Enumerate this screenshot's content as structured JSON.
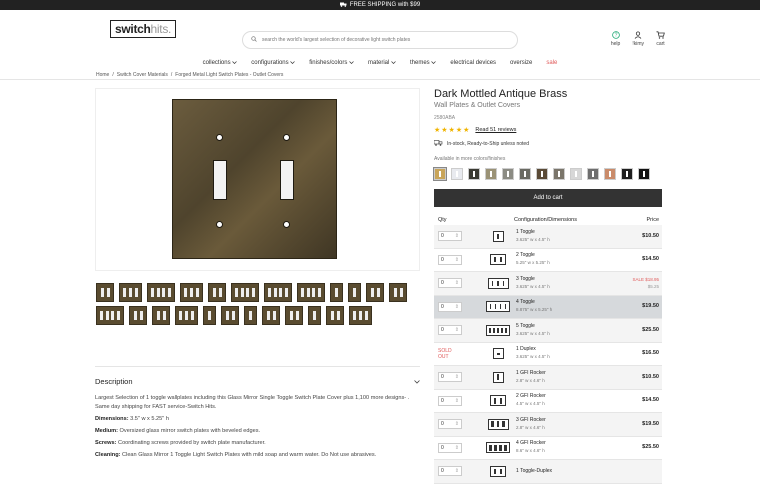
{
  "topbar": {
    "text": "FREE SHIPPING with $99"
  },
  "logo": {
    "part1": "switch",
    "part2": "hits."
  },
  "search": {
    "placeholder": "search the world's largest selection of decorative light switch plates"
  },
  "header_icons": [
    {
      "name": "help",
      "label": "help",
      "icon": "help-icon"
    },
    {
      "name": "account",
      "label": "!kimy",
      "icon": "user-icon"
    },
    {
      "name": "cart",
      "label": "cart",
      "icon": "cart-icon"
    }
  ],
  "nav": [
    "collections",
    "configurations",
    "finishes/colors",
    "material",
    "themes",
    "electrical devices",
    "oversize",
    "sale"
  ],
  "breadcrumb": [
    "Home",
    "Switch Cover Materials",
    "Forged Metal Light Switch Plates - Outlet Covers"
  ],
  "product": {
    "title": "Dark Mottled Antique Brass",
    "subtitle": "Wall Plates & Outlet Covers",
    "sku": "2580ABA",
    "stars": "★★★★★",
    "reviews_link": "Read 51 reviews",
    "stock": "In-stock, Ready-to-Ship unless noted",
    "available_label": "Available in more colors/finishes",
    "add_to_cart": "Add to cart",
    "swatch_colors": [
      "#c9a55a",
      "#e8eaef",
      "#3a3a32",
      "#9a9276",
      "#8b8b83",
      "#6a6a62",
      "#5a4a36",
      "#7a756a",
      "#d7d7d7",
      "#6e6e6e",
      "#c98b6a",
      "#1e1e1e",
      "#111111"
    ]
  },
  "table": {
    "headers": {
      "qty": "Qty",
      "config": "Configuration/Dimensions",
      "price": "Price"
    },
    "rows": [
      {
        "qty": "0",
        "name": "1 Toggle",
        "dims": "3.625\" w x 4.5\" h",
        "price": "$10.50",
        "sale": "",
        "strike": "",
        "gangs": 1,
        "kind": "toggle",
        "soldout": ""
      },
      {
        "qty": "0",
        "name": "2 Toggle",
        "dims": "5.25\" w x 5.25\" h",
        "price": "$14.50",
        "sale": "",
        "strike": "",
        "gangs": 2,
        "kind": "toggle",
        "soldout": ""
      },
      {
        "qty": "0",
        "name": "3 Toggle",
        "dims": "3.625\" w x 4.5\" h",
        "price": "",
        "sale": "SALE $18.95",
        "strike": "$5.25",
        "gangs": 3,
        "kind": "toggle",
        "soldout": ""
      },
      {
        "qty": "0",
        "name": "4 Toggle",
        "dims": "8.875\" w x 5.25\" h",
        "price": "$19.50",
        "sale": "",
        "strike": "",
        "gangs": 4,
        "kind": "toggle",
        "soldout": ""
      },
      {
        "qty": "0",
        "name": "5 Toggle",
        "dims": "3.625\" w x 4.5\" h",
        "price": "$25.50",
        "sale": "",
        "strike": "",
        "gangs": 5,
        "kind": "toggle",
        "soldout": ""
      },
      {
        "qty": "",
        "name": "1 Duplex",
        "dims": "3.625\" w x 4.5\" h",
        "price": "$16.50",
        "sale": "",
        "strike": "",
        "gangs": 1,
        "kind": "duplex",
        "soldout": "SOLD OUT"
      },
      {
        "qty": "0",
        "name": "1 GFI Rocker",
        "dims": "2.8\" w x 4.6\" h",
        "price": "$10.50",
        "sale": "",
        "strike": "",
        "gangs": 1,
        "kind": "gfi",
        "soldout": ""
      },
      {
        "qty": "0",
        "name": "2 GFI Rocker",
        "dims": "4.5\" w x 4.5\" h",
        "price": "$14.50",
        "sale": "",
        "strike": "",
        "gangs": 2,
        "kind": "gfi",
        "soldout": ""
      },
      {
        "qty": "0",
        "name": "3 GFI Rocker",
        "dims": "2.8\" w x 4.6\" h",
        "price": "$19.50",
        "sale": "",
        "strike": "",
        "gangs": 3,
        "kind": "gfi",
        "soldout": ""
      },
      {
        "qty": "0",
        "name": "4 GFI Rocker",
        "dims": "8.6\" w x 4.6\" h",
        "price": "$25.50",
        "sale": "",
        "strike": "",
        "gangs": 4,
        "kind": "gfi",
        "soldout": ""
      },
      {
        "qty": "0",
        "name": "1 Toggle-Duplex",
        "dims": "",
        "price": "",
        "sale": "",
        "strike": "",
        "gangs": 2,
        "kind": "toggle",
        "soldout": ""
      }
    ]
  },
  "description": {
    "heading": "Description",
    "intro": "Largest Selection of 1 toggle wallplates including this Glass Mirror Single Toggle Switch Plate Cover plus 1,100 more designs- . Same day shipping for FAST service-Switch Hits.",
    "specs": [
      {
        "label": "Dimensions:",
        "value": " 3.5\" w x 5.25\" h"
      },
      {
        "label": "Medium:",
        "value": " Oversized glass mirror switch plates with beveled edges."
      },
      {
        "label": "Screws:",
        "value": " Coordinating screws provided by switch plate manufacturer."
      },
      {
        "label": "Cleaning:",
        "value": " Clean Glass Mirror 1 Toggle Light Switch Plates with mild soap and warm water. Do Not use abrasives."
      }
    ]
  },
  "thumbnails": [
    2,
    3,
    4,
    3,
    2,
    4,
    4,
    4,
    1,
    1,
    2,
    2,
    4,
    2,
    2,
    3,
    1,
    2,
    1,
    2,
    2,
    1,
    2,
    3
  ]
}
